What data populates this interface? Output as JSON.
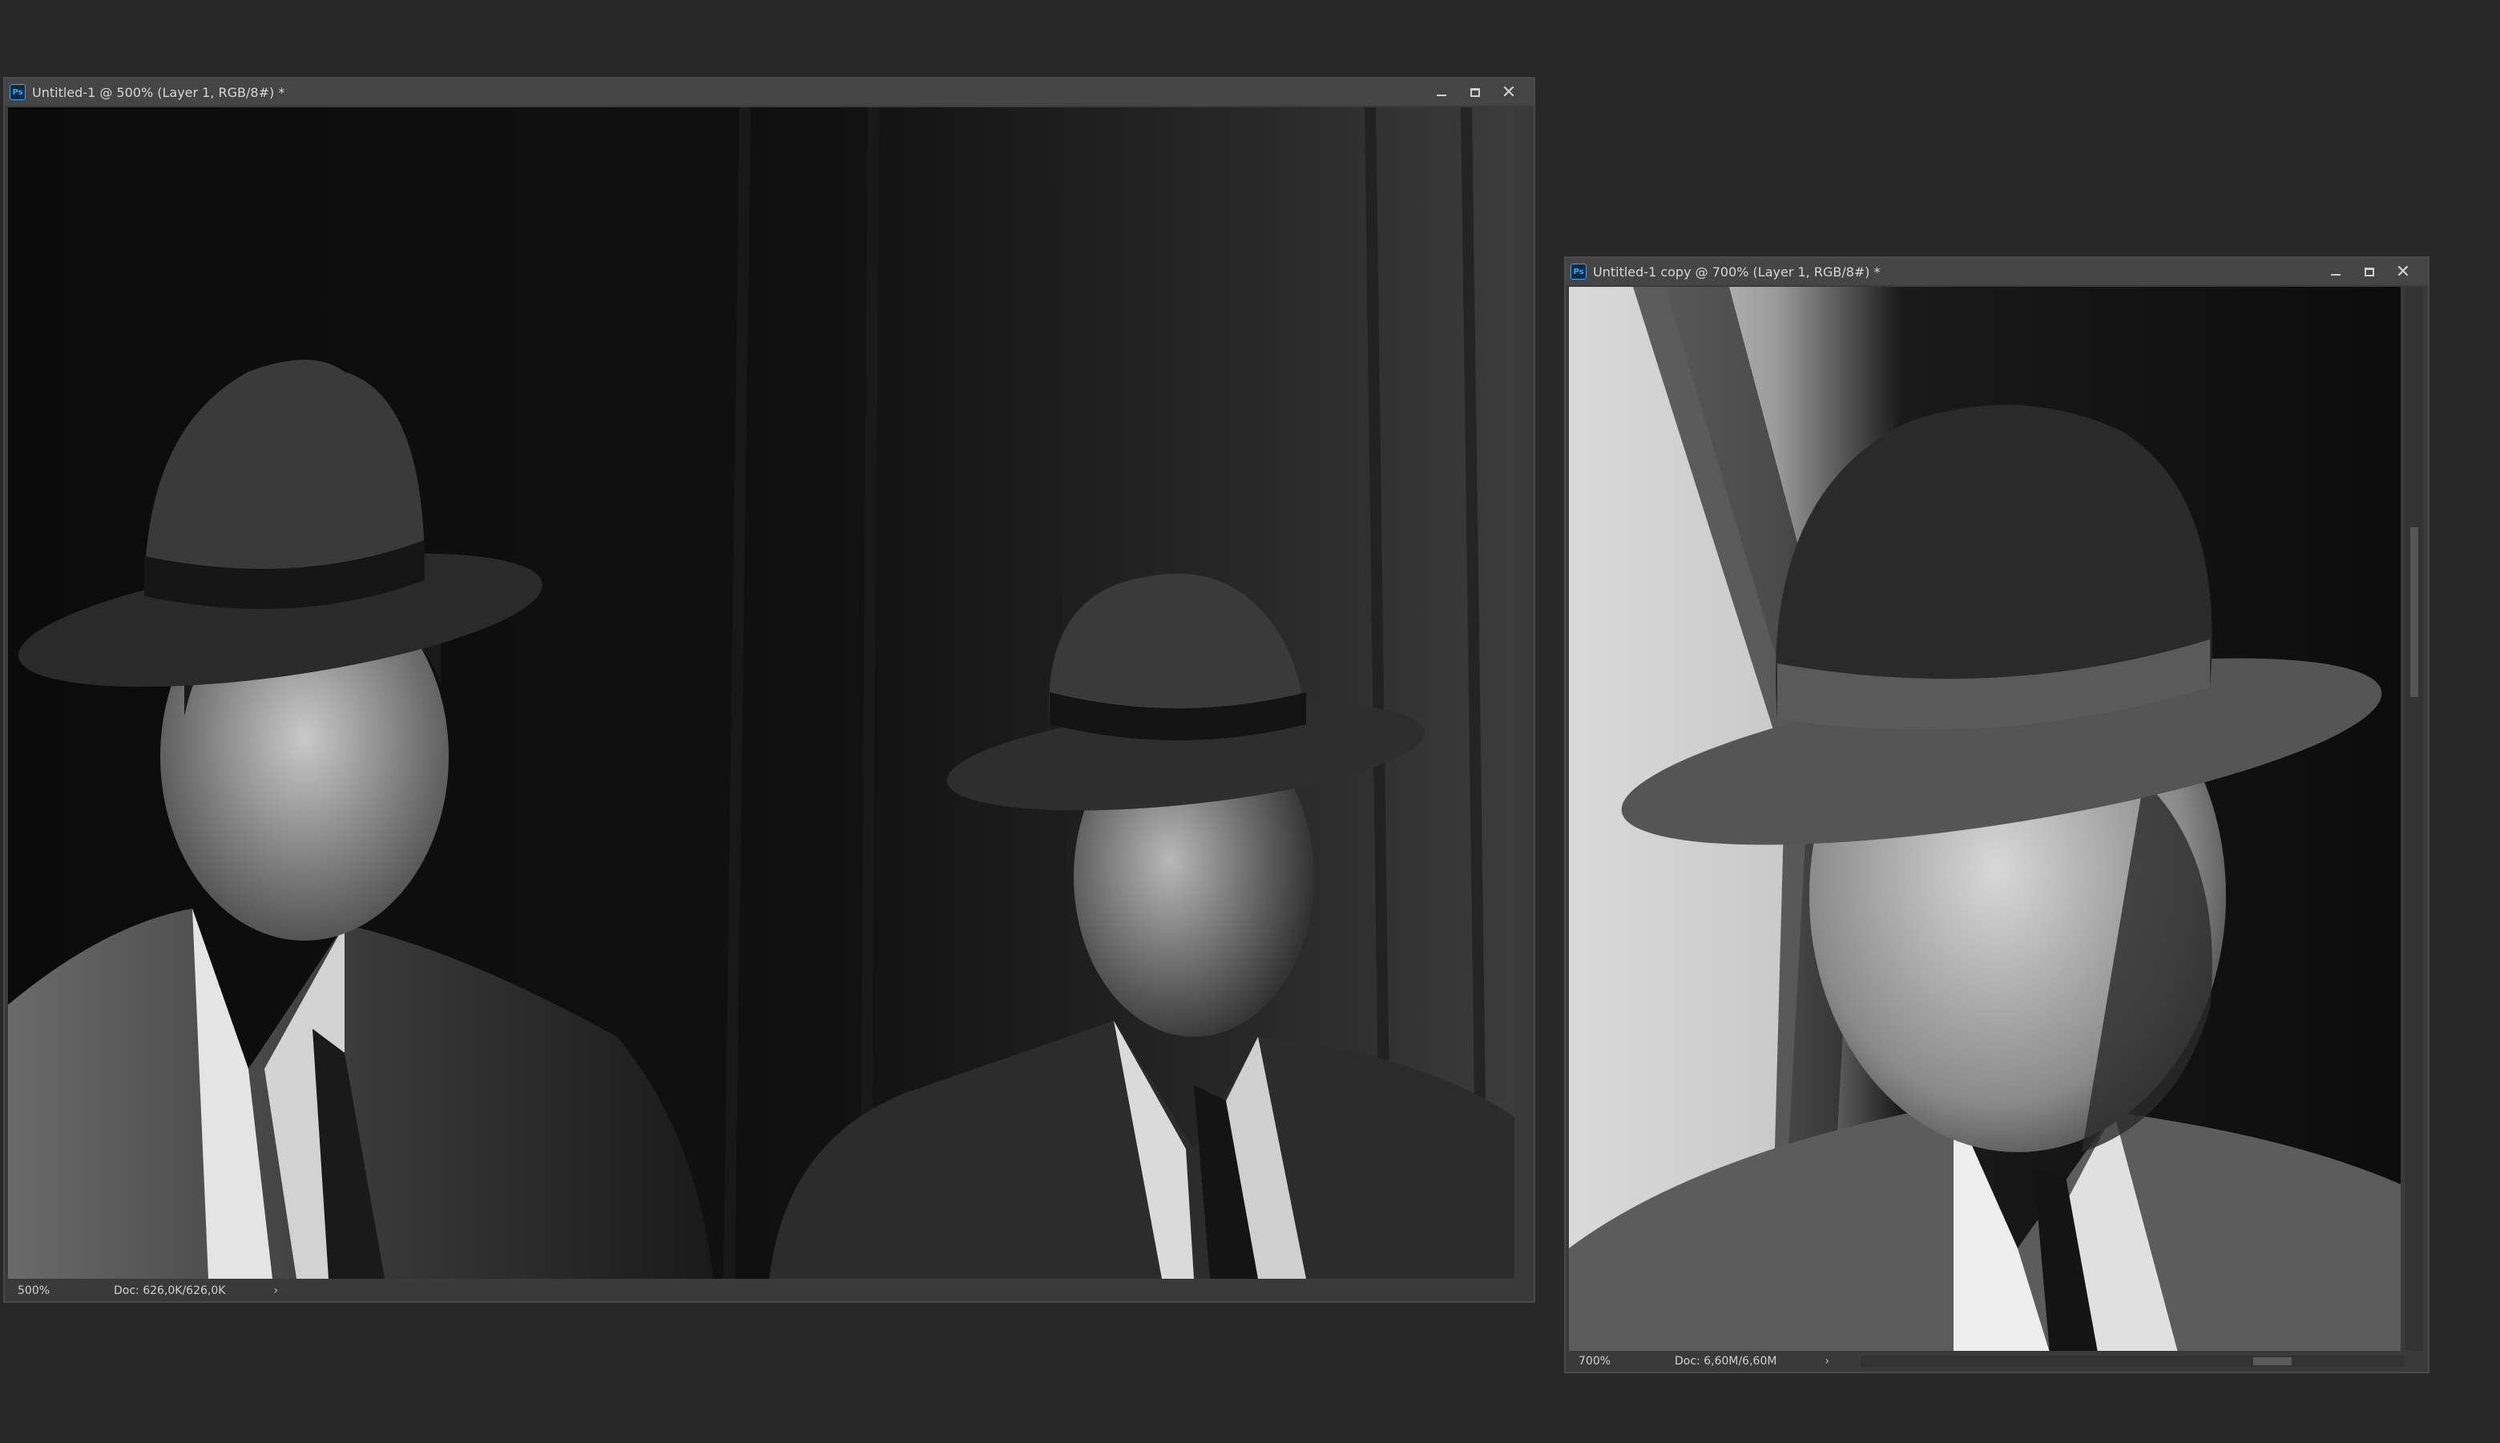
{
  "windows": {
    "left": {
      "title": "Untitled-1 @ 500% (Layer 1, RGB/8#) *",
      "app_icon_label": "Ps",
      "zoom": "500%",
      "doc_info": "Doc: 626,0K/626,0K",
      "status_arrow": "›"
    },
    "right": {
      "title": "Untitled-1 copy @ 700% (Layer 1, RGB/8#) *",
      "app_icon_label": "Ps",
      "zoom": "700%",
      "doc_info": "Doc: 6,60M/6,60M",
      "status_arrow": "›"
    }
  },
  "controls": {
    "close_glyph": "✕"
  },
  "colors": {
    "app_background": "#282828",
    "window_frame": "#3a3a3a",
    "titlebar": "#454545",
    "ps_icon_accent": "#31a8ff"
  }
}
